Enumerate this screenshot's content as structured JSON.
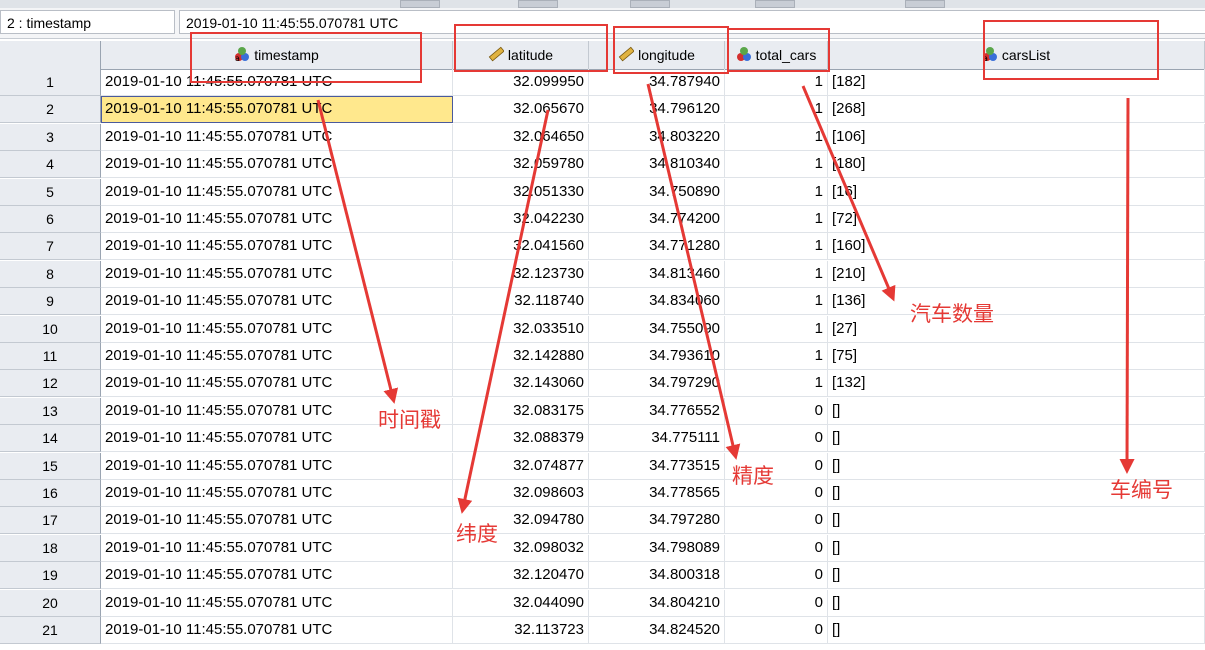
{
  "cell_ref": "2 : timestamp",
  "cell_value": "2019-01-10 11:45:55.070781 UTC",
  "columns": [
    {
      "name": "timestamp",
      "icon": "nominal-string-icon"
    },
    {
      "name": "latitude",
      "icon": "scale-ruler-icon"
    },
    {
      "name": "longitude",
      "icon": "scale-ruler-icon"
    },
    {
      "name": "total_cars",
      "icon": "nominal-icon"
    },
    {
      "name": "carsList",
      "icon": "nominal-string-icon"
    }
  ],
  "rows": [
    {
      "n": "1",
      "timestamp": "2019-01-10 11:45:55.070781 UTC",
      "latitude": "32.099950",
      "longitude": "34.787940",
      "total_cars": "1",
      "carsList": "[182]"
    },
    {
      "n": "2",
      "timestamp": "2019-01-10 11:45:55.070781 UTC",
      "latitude": "32.065670",
      "longitude": "34.796120",
      "total_cars": "1",
      "carsList": "[268]"
    },
    {
      "n": "3",
      "timestamp": "2019-01-10 11:45:55.070781 UTC",
      "latitude": "32.064650",
      "longitude": "34.803220",
      "total_cars": "1",
      "carsList": "[106]"
    },
    {
      "n": "4",
      "timestamp": "2019-01-10 11:45:55.070781 UTC",
      "latitude": "32.059780",
      "longitude": "34.810340",
      "total_cars": "1",
      "carsList": "[180]"
    },
    {
      "n": "5",
      "timestamp": "2019-01-10 11:45:55.070781 UTC",
      "latitude": "32.051330",
      "longitude": "34.750890",
      "total_cars": "1",
      "carsList": "[16]"
    },
    {
      "n": "6",
      "timestamp": "2019-01-10 11:45:55.070781 UTC",
      "latitude": "32.042230",
      "longitude": "34.774200",
      "total_cars": "1",
      "carsList": "[72]"
    },
    {
      "n": "7",
      "timestamp": "2019-01-10 11:45:55.070781 UTC",
      "latitude": "32.041560",
      "longitude": "34.771280",
      "total_cars": "1",
      "carsList": "[160]"
    },
    {
      "n": "8",
      "timestamp": "2019-01-10 11:45:55.070781 UTC",
      "latitude": "32.123730",
      "longitude": "34.813460",
      "total_cars": "1",
      "carsList": "[210]"
    },
    {
      "n": "9",
      "timestamp": "2019-01-10 11:45:55.070781 UTC",
      "latitude": "32.118740",
      "longitude": "34.834060",
      "total_cars": "1",
      "carsList": "[136]"
    },
    {
      "n": "10",
      "timestamp": "2019-01-10 11:45:55.070781 UTC",
      "latitude": "32.033510",
      "longitude": "34.755090",
      "total_cars": "1",
      "carsList": "[27]"
    },
    {
      "n": "11",
      "timestamp": "2019-01-10 11:45:55.070781 UTC",
      "latitude": "32.142880",
      "longitude": "34.793610",
      "total_cars": "1",
      "carsList": "[75]"
    },
    {
      "n": "12",
      "timestamp": "2019-01-10 11:45:55.070781 UTC",
      "latitude": "32.143060",
      "longitude": "34.797290",
      "total_cars": "1",
      "carsList": "[132]"
    },
    {
      "n": "13",
      "timestamp": "2019-01-10 11:45:55.070781 UTC",
      "latitude": "32.083175",
      "longitude": "34.776552",
      "total_cars": "0",
      "carsList": "[]"
    },
    {
      "n": "14",
      "timestamp": "2019-01-10 11:45:55.070781 UTC",
      "latitude": "32.088379",
      "longitude": "34.775111",
      "total_cars": "0",
      "carsList": "[]"
    },
    {
      "n": "15",
      "timestamp": "2019-01-10 11:45:55.070781 UTC",
      "latitude": "32.074877",
      "longitude": "34.773515",
      "total_cars": "0",
      "carsList": "[]"
    },
    {
      "n": "16",
      "timestamp": "2019-01-10 11:45:55.070781 UTC",
      "latitude": "32.098603",
      "longitude": "34.778565",
      "total_cars": "0",
      "carsList": "[]"
    },
    {
      "n": "17",
      "timestamp": "2019-01-10 11:45:55.070781 UTC",
      "latitude": "32.094780",
      "longitude": "34.797280",
      "total_cars": "0",
      "carsList": "[]"
    },
    {
      "n": "18",
      "timestamp": "2019-01-10 11:45:55.070781 UTC",
      "latitude": "32.098032",
      "longitude": "34.798089",
      "total_cars": "0",
      "carsList": "[]"
    },
    {
      "n": "19",
      "timestamp": "2019-01-10 11:45:55.070781 UTC",
      "latitude": "32.120470",
      "longitude": "34.800318",
      "total_cars": "0",
      "carsList": "[]"
    },
    {
      "n": "20",
      "timestamp": "2019-01-10 11:45:55.070781 UTC",
      "latitude": "32.044090",
      "longitude": "34.804210",
      "total_cars": "0",
      "carsList": "[]"
    },
    {
      "n": "21",
      "timestamp": "2019-01-10 11:45:55.070781 UTC",
      "latitude": "32.113723",
      "longitude": "34.824520",
      "total_cars": "0",
      "carsList": "[]"
    }
  ],
  "selected_row": "2",
  "annotations": {
    "timestamp": "时间戳",
    "latitude": "纬度",
    "longitude": "精度",
    "total_cars": "汽车数量",
    "carsList": "车编号"
  },
  "annotation_color": "#e53935",
  "selected_cell_color": "#ffe88d"
}
